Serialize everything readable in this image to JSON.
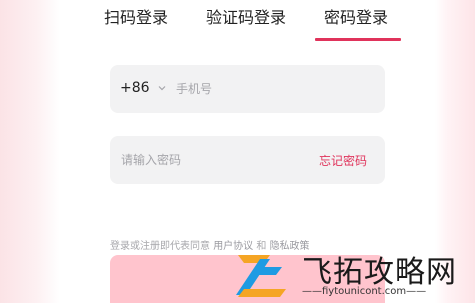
{
  "tabs": [
    {
      "label": "扫码登录"
    },
    {
      "label": "验证码登录"
    },
    {
      "label": "密码登录"
    }
  ],
  "active_tab": "密码登录",
  "phone": {
    "country_code": "+86",
    "placeholder": "手机号"
  },
  "password": {
    "placeholder": "请输入密码",
    "forgot_label": "忘记密码"
  },
  "agreement": {
    "prefix": "登录或注册即代表同意",
    "user_agreement": "用户协议",
    "and": "和",
    "privacy_policy": "隐私政策"
  },
  "watermark": {
    "title": "飞拓攻略网",
    "url": "——fiytounicont.com——"
  },
  "colors": {
    "accent": "#e0335b",
    "button": "#ffc4cd",
    "field_bg": "#f2f2f3"
  }
}
